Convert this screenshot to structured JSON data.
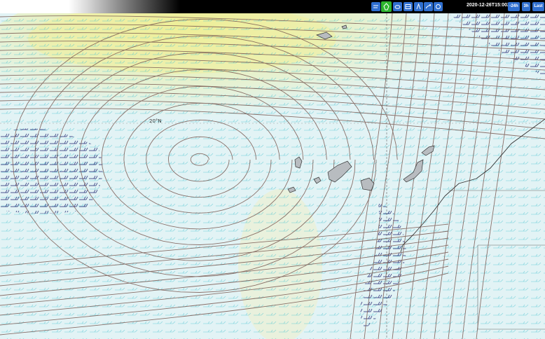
{
  "toolbar": {
    "tools": [
      {
        "name": "wind-tool",
        "icon": "wind-icon"
      },
      {
        "name": "streamline-tool",
        "icon": "streamline-icon",
        "active": true
      },
      {
        "name": "cloud-tool",
        "icon": "cloud-icon"
      },
      {
        "name": "layers-tool",
        "icon": "layers-icon"
      },
      {
        "name": "pressure-tool",
        "icon": "pressure-icon"
      },
      {
        "name": "front-tool",
        "icon": "front-icon"
      },
      {
        "name": "settings-tool",
        "icon": "settings-icon"
      }
    ],
    "colors": {
      "button": "#2f6fd0",
      "active": "#2db52d",
      "bar": "#000000"
    }
  },
  "timestamp": "2020-12-26T15:00Z",
  "nav": {
    "back_label": "-24h",
    "forward_label": "3h",
    "last_label": "Last"
  },
  "map": {
    "latitude_label": "20°N",
    "colors": {
      "streamline": "#7a5a52",
      "barb_light": "#49c2cf",
      "barb_dark": "#1a1f6e",
      "yellow_band": "#f2f0a0",
      "land": "#b8bcc0",
      "coast": "#333333"
    }
  }
}
